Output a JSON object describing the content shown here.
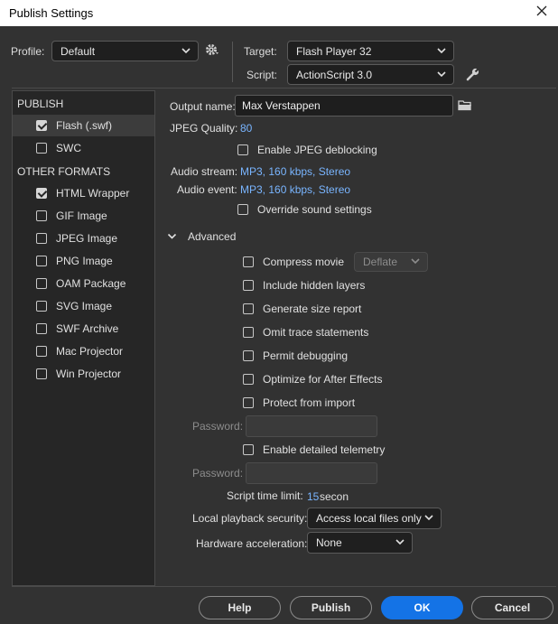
{
  "window": {
    "title": "Publish Settings"
  },
  "header": {
    "profile_label": "Profile:",
    "profile_value": "Default",
    "target_label": "Target:",
    "target_value": "Flash Player 32",
    "script_label": "Script:",
    "script_value": "ActionScript 3.0"
  },
  "sidebar": {
    "publish_heading": "PUBLISH",
    "publish_items": [
      {
        "label": "Flash (.swf)",
        "checked": true,
        "selected": true
      },
      {
        "label": "SWC",
        "checked": false,
        "selected": false
      }
    ],
    "other_heading": "OTHER FORMATS",
    "other_items": [
      {
        "label": "HTML Wrapper",
        "checked": true
      },
      {
        "label": "GIF Image",
        "checked": false
      },
      {
        "label": "JPEG Image",
        "checked": false
      },
      {
        "label": "PNG Image",
        "checked": false
      },
      {
        "label": "OAM Package",
        "checked": false
      },
      {
        "label": "SVG Image",
        "checked": false
      },
      {
        "label": "SWF Archive",
        "checked": false
      },
      {
        "label": "Mac Projector",
        "checked": false
      },
      {
        "label": "Win Projector",
        "checked": false
      }
    ]
  },
  "main": {
    "output_label": "Output name:",
    "output_value": "Max Verstappen",
    "jpeg_quality_label": "JPEG Quality:",
    "jpeg_quality_value": "80",
    "jpeg_deblocking_label": "Enable JPEG deblocking",
    "audio_stream_label": "Audio stream:",
    "audio_stream_value": "MP3, 160 kbps, Stereo",
    "audio_event_label": "Audio event:",
    "audio_event_value": "MP3, 160 kbps, Stereo",
    "override_sound_label": "Override sound settings",
    "advanced_label": "Advanced",
    "compress_movie_label": "Compress movie",
    "compress_method": "Deflate",
    "include_hidden_label": "Include hidden layers",
    "size_report_label": "Generate size report",
    "omit_trace_label": "Omit trace statements",
    "permit_debugging_label": "Permit debugging",
    "optimize_ae_label": "Optimize for After Effects",
    "protect_import_label": "Protect from import",
    "password_label_1": "Password:",
    "telemetry_label": "Enable detailed telemetry",
    "password_label_2": "Password:",
    "script_time_label": "Script time limit:",
    "script_time_value": "15",
    "script_time_unit": "secon",
    "local_playback_label": "Local playback security:",
    "local_playback_value": "Access local files only",
    "hw_accel_label": "Hardware acceleration:",
    "hw_accel_value": "None"
  },
  "footer": {
    "help_label": "Help",
    "publish_label": "Publish",
    "ok_label": "OK",
    "cancel_label": "Cancel"
  },
  "colors": {
    "accent": "#1473e6",
    "link": "#79b5ff",
    "background": "#323232"
  }
}
